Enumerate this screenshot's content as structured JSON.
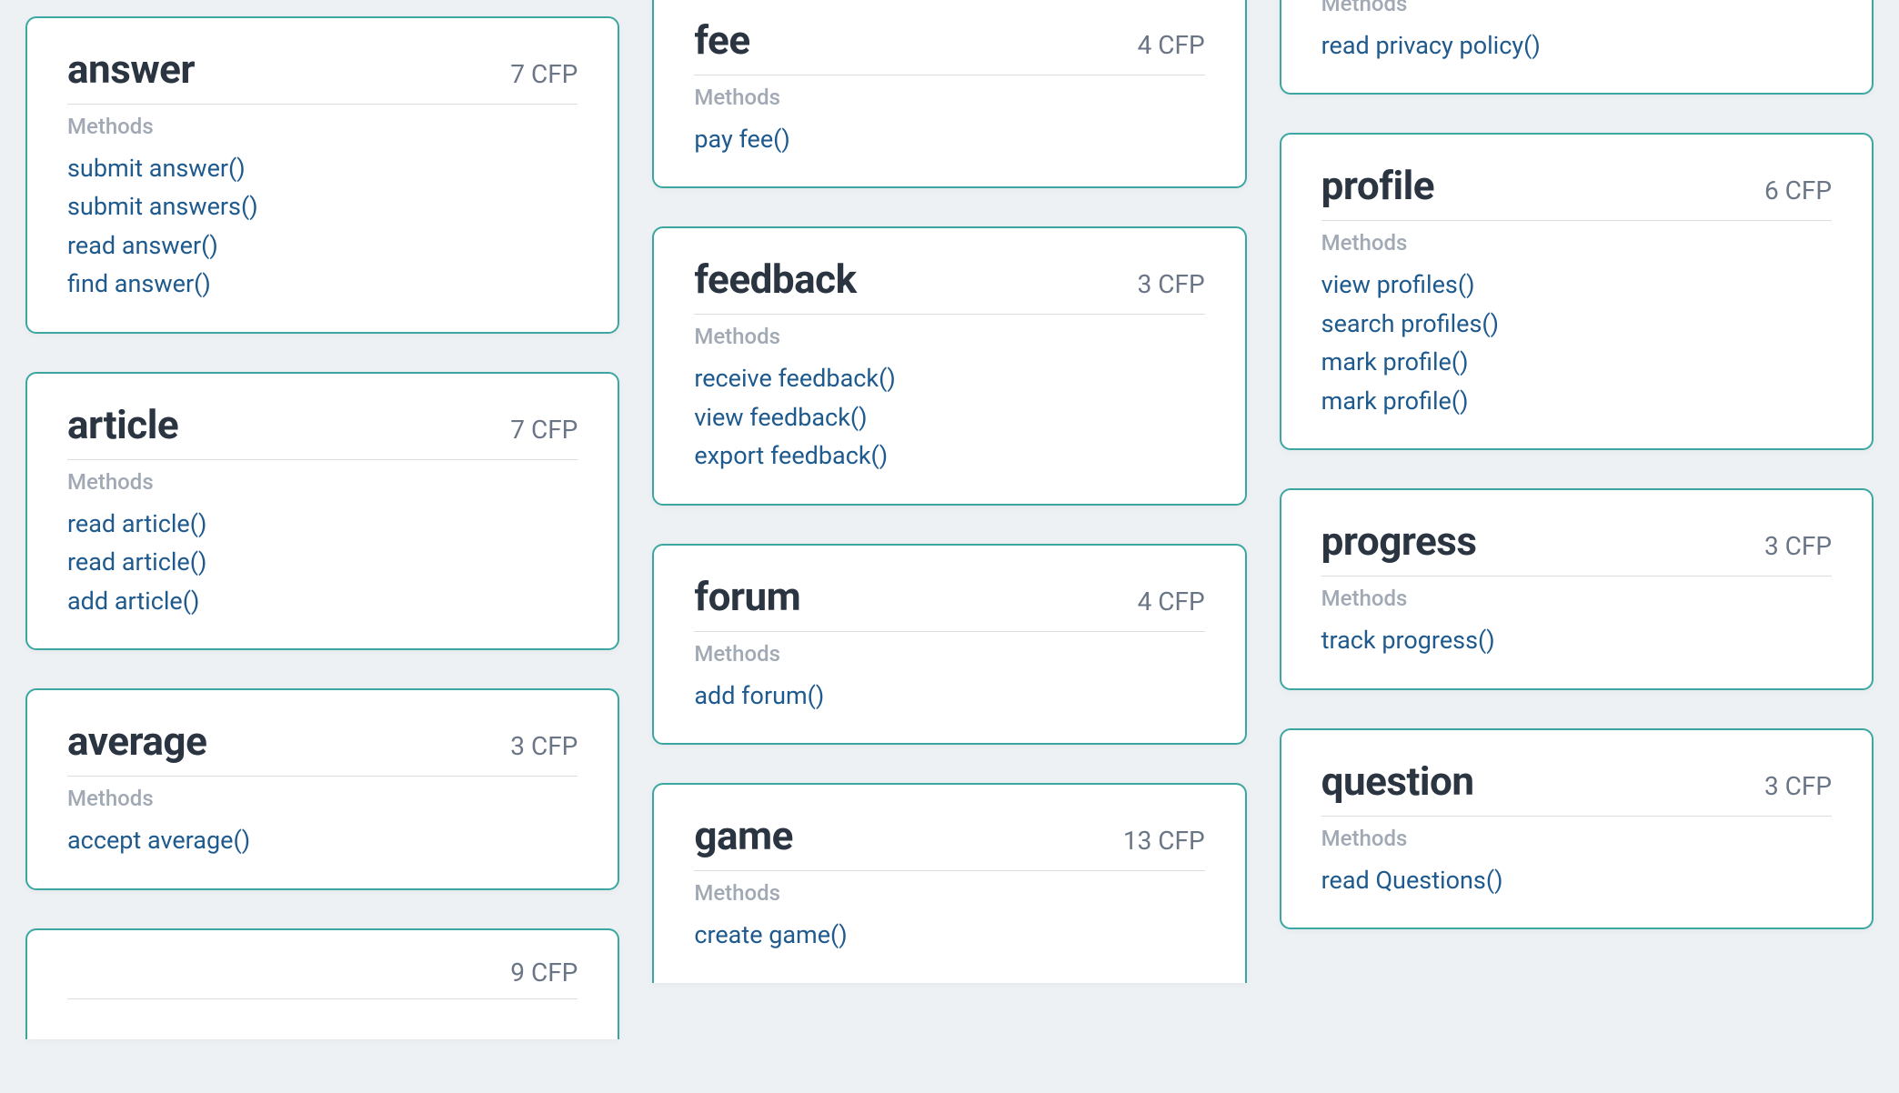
{
  "labels": {
    "methods": "Methods",
    "cfp_unit": "CFP"
  },
  "columns": [
    {
      "offset": "col1",
      "cards": [
        {
          "title": "answer",
          "cfp": 7,
          "methods": [
            "submit answer()",
            "submit answers()",
            "read answer()",
            "find answer()"
          ]
        },
        {
          "title": "article",
          "cfp": 7,
          "methods": [
            "read article()",
            "read article()",
            "add article()"
          ]
        },
        {
          "title": "average",
          "cfp": 3,
          "methods": [
            "accept average()"
          ]
        },
        {
          "partial": "bottom",
          "title": "",
          "cfp": 9,
          "methods": []
        }
      ]
    },
    {
      "offset": "col2",
      "cards": [
        {
          "title": "fee",
          "cfp": 4,
          "methods": [
            "pay fee()"
          ]
        },
        {
          "title": "feedback",
          "cfp": 3,
          "methods": [
            "receive feedback()",
            "view feedback()",
            "export feedback()"
          ]
        },
        {
          "title": "forum",
          "cfp": 4,
          "methods": [
            "add forum()"
          ]
        },
        {
          "partial": "bottom",
          "title": "game",
          "cfp": 13,
          "methods": [
            "create game()"
          ]
        }
      ]
    },
    {
      "offset": "col3",
      "cards": [
        {
          "partial": "top",
          "title": "",
          "cfp": null,
          "methods_label_visible": true,
          "methods": [
            "read privacy policy()"
          ]
        },
        {
          "title": "profile",
          "cfp": 6,
          "methods": [
            "view profiles()",
            "search profiles()",
            "mark profile()",
            "mark profile()"
          ]
        },
        {
          "title": "progress",
          "cfp": 3,
          "methods": [
            "track progress()"
          ]
        },
        {
          "title": "question",
          "cfp": 3,
          "methods": [
            "read Questions()"
          ]
        }
      ]
    }
  ]
}
